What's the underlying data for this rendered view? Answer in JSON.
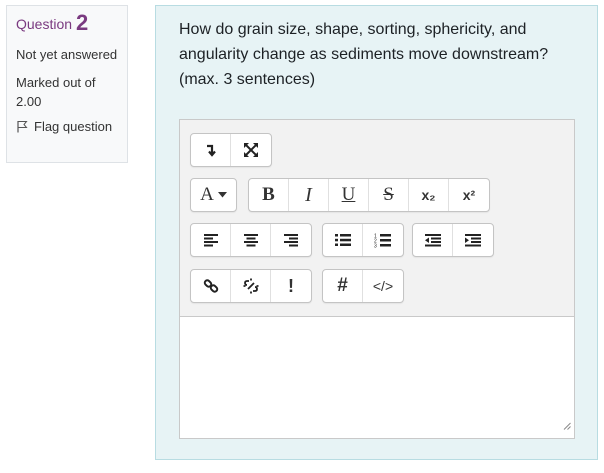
{
  "question_info": {
    "label": "Question",
    "number": "2",
    "state": "Not yet answered",
    "grade": "Marked out of 2.00",
    "flag_label": "Flag question"
  },
  "question": {
    "text": "How do grain size, shape, sorting, sphericity, and angularity change as sediments move downstream? (max. 3 sentences)"
  },
  "toolbar": {
    "bold_label": "B",
    "italic_label": "I",
    "underline_label": "U",
    "strike_label": "S",
    "subscript_label": "x₂",
    "superscript_label": "x²",
    "font_label": "A",
    "hash_label": "#",
    "html_label": "</>",
    "accessibility_label": "!"
  },
  "answer": {
    "value": ""
  },
  "colors": {
    "accent": "#7a3a80",
    "content_bg": "#e7f3f5",
    "info_bg": "#f8f9fa",
    "toolbar_bg": "#f2f2f2"
  }
}
